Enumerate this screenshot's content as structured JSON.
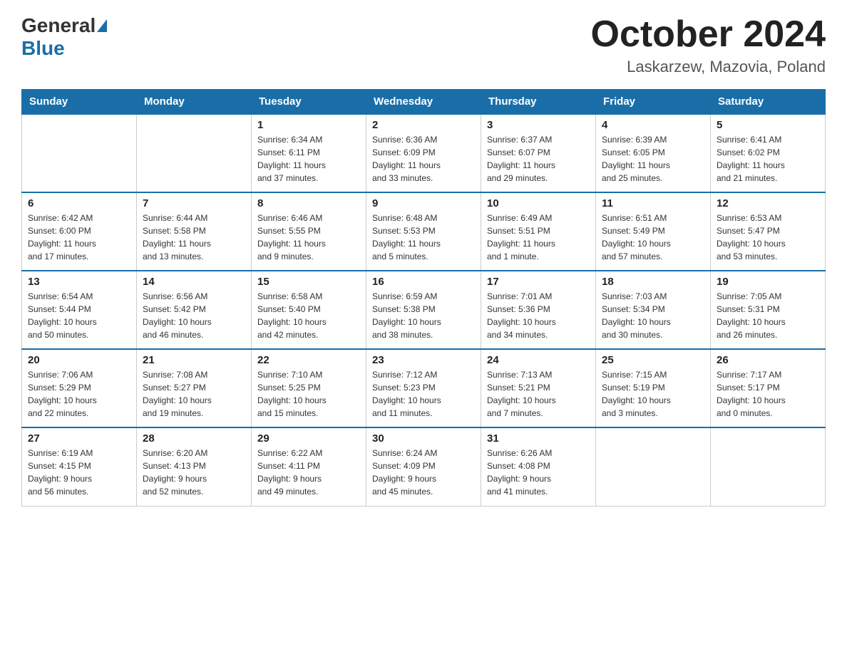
{
  "header": {
    "logo_general": "General",
    "logo_blue": "Blue",
    "month_title": "October 2024",
    "location": "Laskarzew, Mazovia, Poland"
  },
  "weekdays": [
    "Sunday",
    "Monday",
    "Tuesday",
    "Wednesday",
    "Thursday",
    "Friday",
    "Saturday"
  ],
  "weeks": [
    [
      {
        "day": "",
        "info": ""
      },
      {
        "day": "",
        "info": ""
      },
      {
        "day": "1",
        "info": "Sunrise: 6:34 AM\nSunset: 6:11 PM\nDaylight: 11 hours\nand 37 minutes."
      },
      {
        "day": "2",
        "info": "Sunrise: 6:36 AM\nSunset: 6:09 PM\nDaylight: 11 hours\nand 33 minutes."
      },
      {
        "day": "3",
        "info": "Sunrise: 6:37 AM\nSunset: 6:07 PM\nDaylight: 11 hours\nand 29 minutes."
      },
      {
        "day": "4",
        "info": "Sunrise: 6:39 AM\nSunset: 6:05 PM\nDaylight: 11 hours\nand 25 minutes."
      },
      {
        "day": "5",
        "info": "Sunrise: 6:41 AM\nSunset: 6:02 PM\nDaylight: 11 hours\nand 21 minutes."
      }
    ],
    [
      {
        "day": "6",
        "info": "Sunrise: 6:42 AM\nSunset: 6:00 PM\nDaylight: 11 hours\nand 17 minutes."
      },
      {
        "day": "7",
        "info": "Sunrise: 6:44 AM\nSunset: 5:58 PM\nDaylight: 11 hours\nand 13 minutes."
      },
      {
        "day": "8",
        "info": "Sunrise: 6:46 AM\nSunset: 5:55 PM\nDaylight: 11 hours\nand 9 minutes."
      },
      {
        "day": "9",
        "info": "Sunrise: 6:48 AM\nSunset: 5:53 PM\nDaylight: 11 hours\nand 5 minutes."
      },
      {
        "day": "10",
        "info": "Sunrise: 6:49 AM\nSunset: 5:51 PM\nDaylight: 11 hours\nand 1 minute."
      },
      {
        "day": "11",
        "info": "Sunrise: 6:51 AM\nSunset: 5:49 PM\nDaylight: 10 hours\nand 57 minutes."
      },
      {
        "day": "12",
        "info": "Sunrise: 6:53 AM\nSunset: 5:47 PM\nDaylight: 10 hours\nand 53 minutes."
      }
    ],
    [
      {
        "day": "13",
        "info": "Sunrise: 6:54 AM\nSunset: 5:44 PM\nDaylight: 10 hours\nand 50 minutes."
      },
      {
        "day": "14",
        "info": "Sunrise: 6:56 AM\nSunset: 5:42 PM\nDaylight: 10 hours\nand 46 minutes."
      },
      {
        "day": "15",
        "info": "Sunrise: 6:58 AM\nSunset: 5:40 PM\nDaylight: 10 hours\nand 42 minutes."
      },
      {
        "day": "16",
        "info": "Sunrise: 6:59 AM\nSunset: 5:38 PM\nDaylight: 10 hours\nand 38 minutes."
      },
      {
        "day": "17",
        "info": "Sunrise: 7:01 AM\nSunset: 5:36 PM\nDaylight: 10 hours\nand 34 minutes."
      },
      {
        "day": "18",
        "info": "Sunrise: 7:03 AM\nSunset: 5:34 PM\nDaylight: 10 hours\nand 30 minutes."
      },
      {
        "day": "19",
        "info": "Sunrise: 7:05 AM\nSunset: 5:31 PM\nDaylight: 10 hours\nand 26 minutes."
      }
    ],
    [
      {
        "day": "20",
        "info": "Sunrise: 7:06 AM\nSunset: 5:29 PM\nDaylight: 10 hours\nand 22 minutes."
      },
      {
        "day": "21",
        "info": "Sunrise: 7:08 AM\nSunset: 5:27 PM\nDaylight: 10 hours\nand 19 minutes."
      },
      {
        "day": "22",
        "info": "Sunrise: 7:10 AM\nSunset: 5:25 PM\nDaylight: 10 hours\nand 15 minutes."
      },
      {
        "day": "23",
        "info": "Sunrise: 7:12 AM\nSunset: 5:23 PM\nDaylight: 10 hours\nand 11 minutes."
      },
      {
        "day": "24",
        "info": "Sunrise: 7:13 AM\nSunset: 5:21 PM\nDaylight: 10 hours\nand 7 minutes."
      },
      {
        "day": "25",
        "info": "Sunrise: 7:15 AM\nSunset: 5:19 PM\nDaylight: 10 hours\nand 3 minutes."
      },
      {
        "day": "26",
        "info": "Sunrise: 7:17 AM\nSunset: 5:17 PM\nDaylight: 10 hours\nand 0 minutes."
      }
    ],
    [
      {
        "day": "27",
        "info": "Sunrise: 6:19 AM\nSunset: 4:15 PM\nDaylight: 9 hours\nand 56 minutes."
      },
      {
        "day": "28",
        "info": "Sunrise: 6:20 AM\nSunset: 4:13 PM\nDaylight: 9 hours\nand 52 minutes."
      },
      {
        "day": "29",
        "info": "Sunrise: 6:22 AM\nSunset: 4:11 PM\nDaylight: 9 hours\nand 49 minutes."
      },
      {
        "day": "30",
        "info": "Sunrise: 6:24 AM\nSunset: 4:09 PM\nDaylight: 9 hours\nand 45 minutes."
      },
      {
        "day": "31",
        "info": "Sunrise: 6:26 AM\nSunset: 4:08 PM\nDaylight: 9 hours\nand 41 minutes."
      },
      {
        "day": "",
        "info": ""
      },
      {
        "day": "",
        "info": ""
      }
    ]
  ]
}
